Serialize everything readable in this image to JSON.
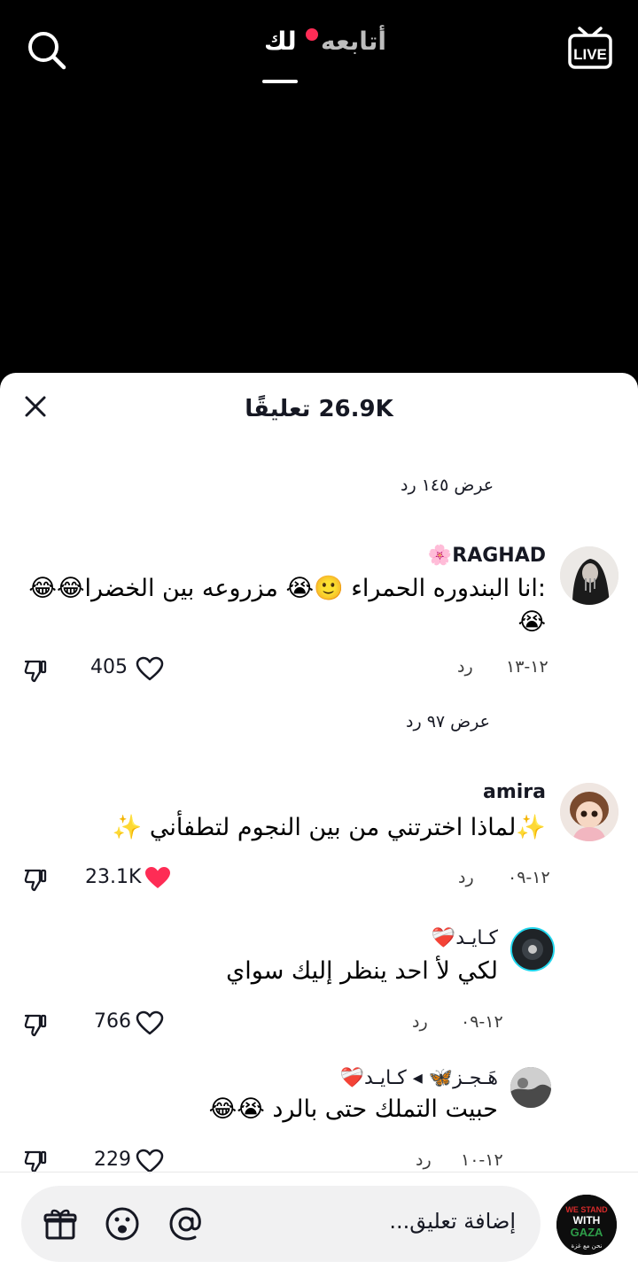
{
  "topbar": {
    "tab_following": "أتابعه",
    "tab_foryou": "لك",
    "live_label": "LIVE",
    "accent": "#fe2c55"
  },
  "sheet": {
    "title": "26.9K تعليقًا",
    "view_replies_1": "عرض ١٤٥ رد",
    "view_replies_2": "عرض ٩٧ رد"
  },
  "comments": [
    {
      "username": "RAGHAD🌸",
      "text_line1": ":انا البندوره الحمراء 🙂😭 مزروعه بين الخضرا😂😂",
      "text_line2": "😭",
      "date": "١٢-١٣",
      "reply_label": "رد",
      "likes": "405",
      "liked": false
    },
    {
      "username": "amira",
      "text_line1": "✨لماذا اخترتني من بين النجوم لتطفأني ✨",
      "date": "١٢-٠٩",
      "reply_label": "رد",
      "likes": "23.1K",
      "liked": true
    },
    {
      "username": "كـايـد❤️‍🩹",
      "text_line1": "لكي لأ احد ينظر إليك سواي",
      "date": "١٢-٠٩",
      "reply_label": "رد",
      "likes": "766",
      "liked": false
    },
    {
      "username": "هَـجـز🦋 ◂ كـايـد❤️‍🩹",
      "text_line1": "حبيت التملك حتى بالرد 😭😂",
      "date": "١٢-١٠",
      "reply_label": "رد",
      "likes": "229",
      "liked": false
    }
  ],
  "footer": {
    "placeholder": "إضافة تعليق...",
    "avatar_text_1": "WE STAND",
    "avatar_text_2": "WITH",
    "avatar_text_3": "GAZA",
    "avatar_text_4": "نحن مع غزة"
  }
}
